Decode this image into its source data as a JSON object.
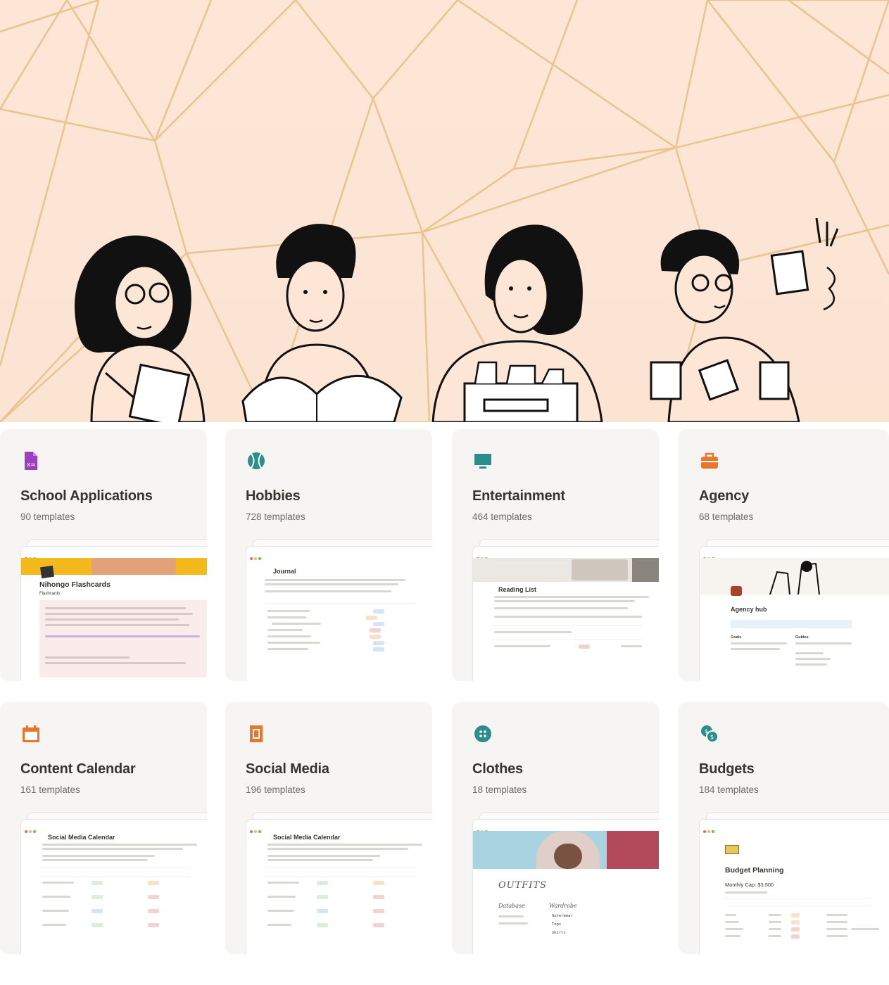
{
  "hero": {
    "background_color": "#fde6d6",
    "line_color": "#e9c48e",
    "illustration": "four-people-working-illustration"
  },
  "categories": [
    {
      "title": "School Applications",
      "count": "90 templates",
      "icon": "document-formula-icon",
      "icon_color": "#9b40bf",
      "preview_title": "Nihongo Flashcards",
      "preview_subtitle": "Flashcards"
    },
    {
      "title": "Hobbies",
      "count": "728 templates",
      "icon": "tennis-ball-icon",
      "icon_color": "#2a8e8a",
      "preview_title": "Journal"
    },
    {
      "title": "Entertainment",
      "count": "464 templates",
      "icon": "television-icon",
      "icon_color": "#2a8e8a",
      "preview_title": "Reading List"
    },
    {
      "title": "Agency",
      "count": "68 templates",
      "icon": "briefcase-icon",
      "icon_color": "#e8762d",
      "preview_title": "Agency hub",
      "preview_col1": "Goals",
      "preview_col2": "Guides"
    },
    {
      "title": "Content Calendar",
      "count": "161 templates",
      "icon": "calendar-icon",
      "icon_color": "#e8762d",
      "preview_title": "Social Media Calendar"
    },
    {
      "title": "Social Media",
      "count": "196 templates",
      "icon": "stamp-icon",
      "icon_color": "#e8762d",
      "preview_title": "Social Media Calendar"
    },
    {
      "title": "Clothes",
      "count": "18 templates",
      "icon": "button-icon",
      "icon_color": "#2a8e8a",
      "preview_title": "OUTFITS",
      "preview_col1": "Database",
      "preview_col2": "Wardrobe",
      "preview_items": [
        "Outerwear",
        "Tops",
        "Shirts"
      ]
    },
    {
      "title": "Budgets",
      "count": "184 templates",
      "icon": "money-exchange-icon",
      "icon_color": "#2a8e8a",
      "preview_title": "Budget Planning",
      "preview_subtitle": "Monthly Cap: $3,500"
    }
  ]
}
